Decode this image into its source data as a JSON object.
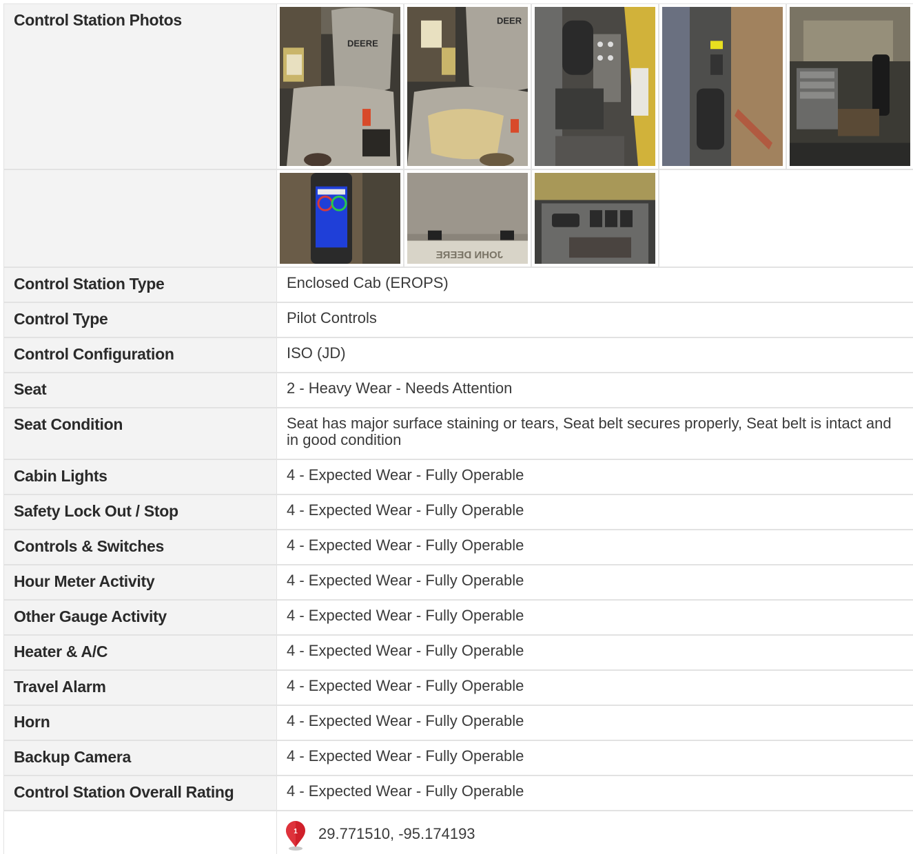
{
  "rows": {
    "photos_label": "Control Station Photos",
    "photos_label_2": "",
    "control_station_type": {
      "label": "Control Station Type",
      "value": "Enclosed Cab (EROPS)"
    },
    "control_type": {
      "label": "Control Type",
      "value": "Pilot Controls"
    },
    "control_configuration": {
      "label": "Control Configuration",
      "value": "ISO (JD)"
    },
    "seat": {
      "label": "Seat",
      "value": "2 - Heavy Wear - Needs Attention"
    },
    "seat_condition": {
      "label": "Seat Condition",
      "value": "Seat has major surface staining or tears, Seat belt secures properly, Seat belt is intact and in good condition"
    },
    "cabin_lights": {
      "label": "Cabin Lights",
      "value": "4 - Expected Wear - Fully Operable"
    },
    "safety_lock": {
      "label": "Safety Lock Out / Stop",
      "value": "4 - Expected Wear - Fully Operable"
    },
    "controls_switches": {
      "label": "Controls & Switches",
      "value": "4 - Expected Wear - Fully Operable"
    },
    "hour_meter": {
      "label": "Hour Meter Activity",
      "value": "4 - Expected Wear - Fully Operable"
    },
    "other_gauge": {
      "label": "Other Gauge Activity",
      "value": "4 - Expected Wear - Fully Operable"
    },
    "heater_ac": {
      "label": "Heater & A/C",
      "value": "4 - Expected Wear - Fully Operable"
    },
    "travel_alarm": {
      "label": "Travel Alarm",
      "value": "4 - Expected Wear - Fully Operable"
    },
    "horn": {
      "label": "Horn",
      "value": "4 - Expected Wear - Fully Operable"
    },
    "backup_camera": {
      "label": "Backup Camera",
      "value": "4 - Expected Wear - Fully Operable"
    },
    "overall_rating": {
      "label": "Control Station Overall Rating",
      "value": "4 - Expected Wear - Fully Operable"
    },
    "location": {
      "label": "",
      "coords": "29.771510, -95.174193",
      "pin_badge": "1"
    }
  },
  "photos": {
    "seat_text_1": "DEERE",
    "seat_text_2": "DEER",
    "visor_text": "JOHN DEERE"
  },
  "colors": {
    "label_bg": "#f3f3f3",
    "border": "#e2e2e2",
    "pin_red": "#d0202a"
  }
}
